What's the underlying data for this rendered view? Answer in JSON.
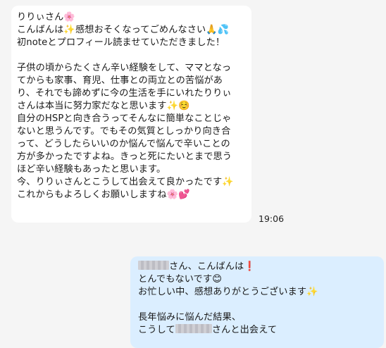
{
  "incoming": {
    "lines": [
      "りりぃさん🌸",
      "こんばんは✨感想おそくなってごめんなさい🙏💦",
      "初noteとプロフィール読ませていただきました！",
      "",
      "子供の頃からたくさん辛い経験をして、ママとなっ",
      "てからも家事、育児、仕事との両立との苦悩があ",
      "り、それでも諦めずに今の生活を手にいれたりりぃ",
      "さんは本当に努力家だなと思います✨☺️",
      "自分のHSPと向き合うってそんなに簡単なことじゃ",
      "ないと思うんです。でもその気質としっかり向き合",
      "って、どうしたらいいのか悩んで悩んで辛いことの",
      "方が多かったですよね。きっと死にたいとまで思う",
      "ほど辛い経験もあったと思います。",
      "今、りりぃさんとこうして出会えて良かったです✨",
      "これからもよろしくお願いしますね🌸💕"
    ],
    "time": "19:06"
  },
  "outgoing": {
    "line1_suffix": "さん、こんばんは❗",
    "line2": "とんでもないです😊",
    "line3": "お忙しい中、感想ありがとうございます✨",
    "line5": "長年悩みに悩んだ結果、",
    "line6_prefix": "こうして",
    "line6_suffix": "さんと出会えて"
  }
}
